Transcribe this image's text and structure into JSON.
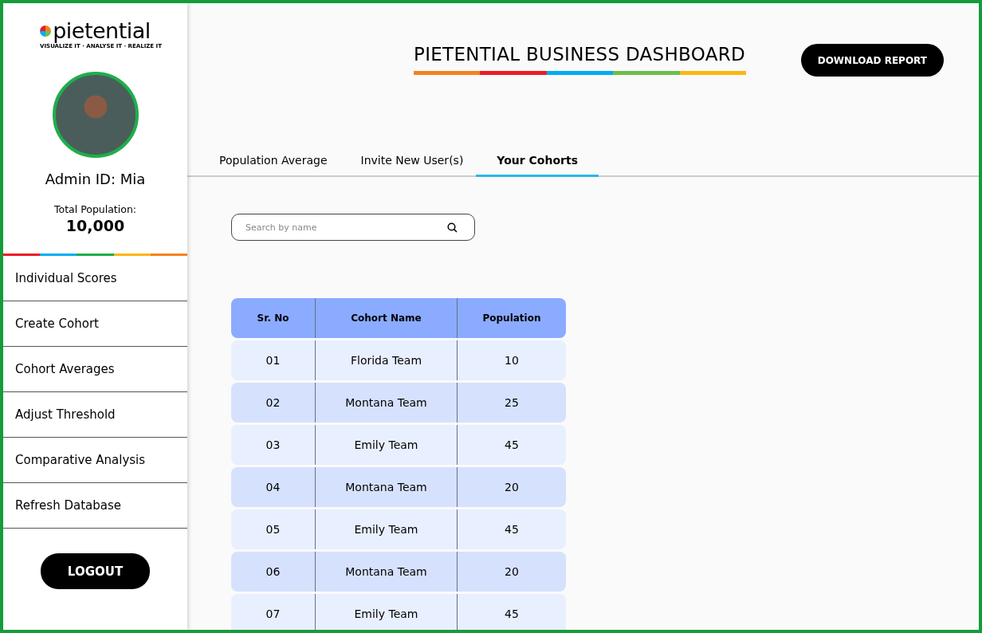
{
  "brand": {
    "name": "pietential",
    "tagline": "VISUALIZE IT · ANALYSE IT · REALIZE IT"
  },
  "profile": {
    "admin": "Admin ID: Mia",
    "population_label": "Total Population:",
    "population": "10,000"
  },
  "nav": [
    {
      "label": "Individual Scores",
      "selected": false
    },
    {
      "label": "Create Cohort",
      "selected": false
    },
    {
      "label": "Cohort Averages",
      "selected": false
    },
    {
      "label": "Adjust Threshold",
      "selected": false
    },
    {
      "label": "Comparative Analysis",
      "selected": false
    },
    {
      "label": "Refresh Database",
      "selected": false
    }
  ],
  "logout": "LOGOUT",
  "header": {
    "title": "PIETENTIAL BUSINESS DASHBOARD",
    "download": "DOWNLOAD REPORT"
  },
  "tabs": [
    {
      "label": "Population Average",
      "selected": false
    },
    {
      "label": "Invite New User(s)",
      "selected": false
    },
    {
      "label": "Your Cohorts",
      "selected": true
    }
  ],
  "search": {
    "placeholder": "Search by name"
  },
  "table": {
    "columns": [
      "Sr. No",
      "Cohort Name",
      "Population"
    ],
    "rows": [
      [
        "01",
        "Florida Team",
        "10"
      ],
      [
        "02",
        "Montana Team",
        "25"
      ],
      [
        "03",
        "Emily Team",
        "45"
      ],
      [
        "04",
        "Montana Team",
        "20"
      ],
      [
        "05",
        "Emily Team",
        "45"
      ],
      [
        "06",
        "Montana Team",
        "20"
      ],
      [
        "07",
        "Emily Team",
        "45"
      ]
    ]
  }
}
